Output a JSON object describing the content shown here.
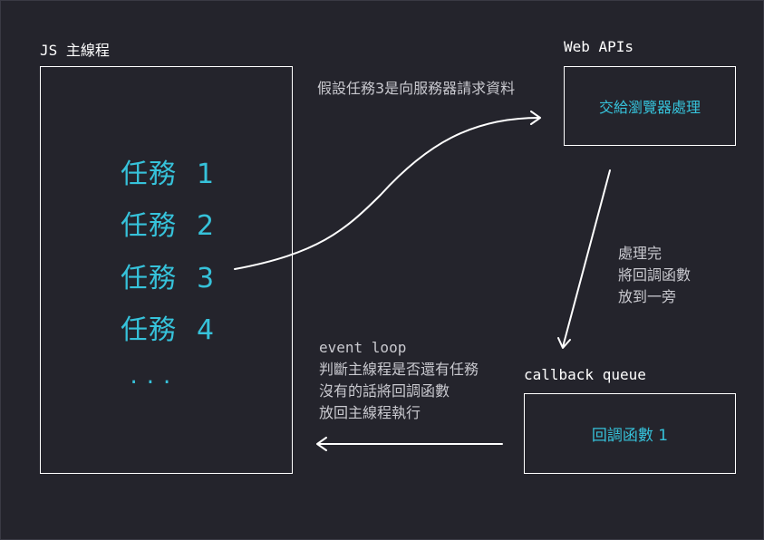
{
  "js_thread": {
    "title": "JS 主線程",
    "tasks": [
      {
        "label": "任務",
        "num": "1"
      },
      {
        "label": "任務",
        "num": "2"
      },
      {
        "label": "任務",
        "num": "3"
      },
      {
        "label": "任務",
        "num": "4"
      }
    ],
    "ellipsis": "..."
  },
  "web_apis": {
    "title": "Web APIs",
    "box_text": "交給瀏覽器處理"
  },
  "notes": {
    "request": "假設任務3是向服務器請求資料",
    "processed": [
      "處理完",
      "將回調函數",
      "放到一旁"
    ],
    "event_loop": [
      "event loop",
      "判斷主線程是否還有任務",
      "沒有的話將回調函數",
      "放回主線程執行"
    ]
  },
  "callback_queue": {
    "title": "callback queue",
    "box_text": "回調函數 1"
  },
  "colors": {
    "background": "#24242c",
    "accent": "#36c2da",
    "line": "#ffffff",
    "note": "#c9c9cf"
  }
}
